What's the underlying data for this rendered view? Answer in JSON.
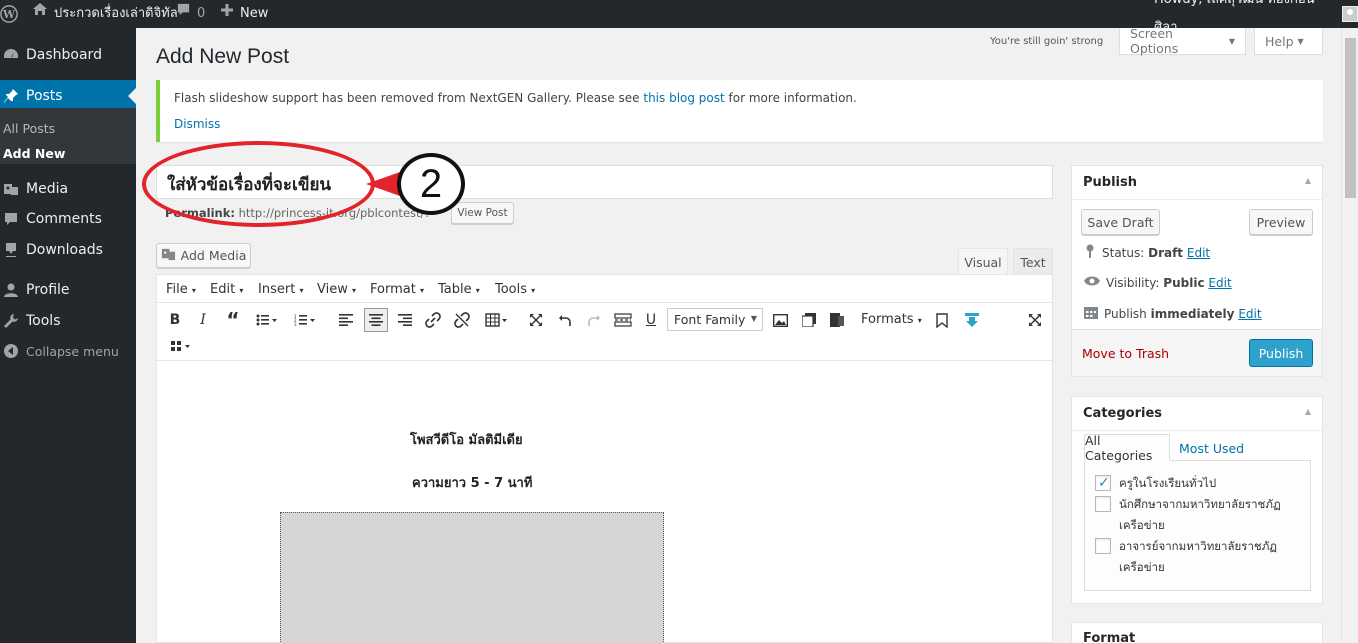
{
  "adminbar": {
    "site_name": "ประกวดเรื่องเล่าดิจิทัล",
    "comments_count": "0",
    "new_label": "New",
    "howdy": "Howdy, เลิศสุวัฒน์ ทองก้อนศิลา"
  },
  "menu": {
    "dashboard": "Dashboard",
    "posts": "Posts",
    "all_posts": "All Posts",
    "add_new": "Add New",
    "media": "Media",
    "comments": "Comments",
    "downloads": "Downloads",
    "profile": "Profile",
    "tools": "Tools",
    "collapse": "Collapse menu"
  },
  "header": {
    "motto": "You're still goin' strong",
    "screen_options": "Screen Options",
    "help": "Help",
    "page_title": "Add New Post"
  },
  "notice": {
    "text_before": "Flash slideshow support has been removed from NextGEN Gallery. Please see",
    "link": "this blog post",
    "text_after": "for more information.",
    "dismiss": "Dismiss"
  },
  "post": {
    "title_value": "ใส่หัวข้อเรื่องที่จะเขียน",
    "permalink_label": "Permalink:",
    "permalink_url": "http://princess-it.org/pblcontest/?",
    "view_post": "View Post",
    "annotation_number": "2"
  },
  "editor": {
    "add_media": "Add Media",
    "tab_visual": "Visual",
    "tab_text": "Text",
    "menus": [
      "File",
      "Edit",
      "Insert",
      "View",
      "Format",
      "Table",
      "Tools"
    ],
    "font_family": "Font Family",
    "formats": "Formats",
    "content_line1": "โพสวีดีโอ มัลติมีเดีย",
    "content_line2": "ความยาว 5 - 7 นาที"
  },
  "publish": {
    "heading": "Publish",
    "save_draft": "Save Draft",
    "preview": "Preview",
    "status_label": "Status:",
    "status_value": "Draft",
    "visibility_label": "Visibility:",
    "visibility_value": "Public",
    "publish_label": "Publish",
    "publish_value": "immediately",
    "edit": "Edit",
    "trash": "Move to Trash",
    "publish_button": "Publish"
  },
  "categories": {
    "heading": "Categories",
    "tab_all": "All Categories",
    "tab_most": "Most Used",
    "items": [
      {
        "label": "ครูในโรงเรียนทั่วไป",
        "checked": true
      },
      {
        "label": "นักศึกษาจากมหาวิทยาลัยราชภัฏเครือข่าย",
        "checked": false
      },
      {
        "label": "อาจารย์จากมหาวิทยาลัยราชภัฏเครือข่าย",
        "checked": false
      }
    ]
  },
  "format_box": {
    "heading": "Format"
  },
  "colors": {
    "admin_bar": "#23282d",
    "active_menu": "#0073aa",
    "annotation_red": "#e2232a",
    "publish_blue": "#2ea2cc",
    "notice_green": "#7ad03a"
  }
}
